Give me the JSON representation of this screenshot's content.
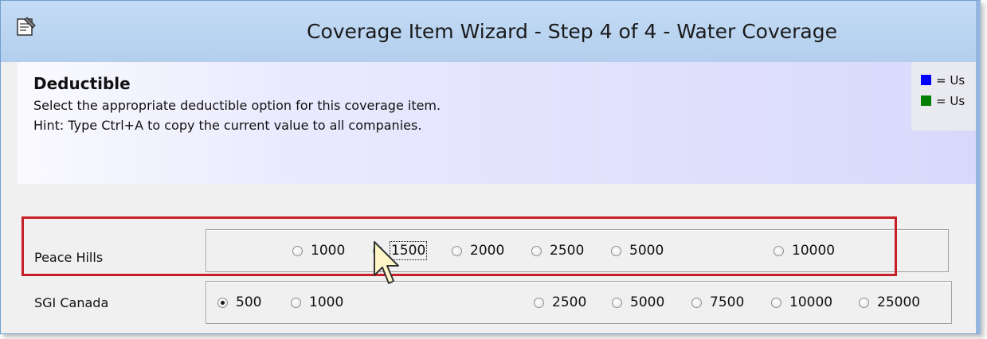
{
  "window": {
    "title": "Coverage Item Wizard - Step 4 of 4 - Water Coverage",
    "icon": "properties-icon"
  },
  "header": {
    "title": "Deductible",
    "description": "Select the appropriate deductible option for this coverage item.",
    "hint": "Hint: Type Ctrl+A to copy the current value to all companies."
  },
  "legend": {
    "items": [
      {
        "color": "#0000ff",
        "label": "= Us"
      },
      {
        "color": "#008000",
        "label": "= Us"
      }
    ]
  },
  "companies": [
    {
      "name": "Peace Hills",
      "selected": "1500",
      "options": [
        "1000",
        "1500",
        "2000",
        "2500",
        "5000",
        "10000"
      ]
    },
    {
      "name": "SGI Canada",
      "selected": "500",
      "options": [
        "500",
        "1000",
        "2500",
        "5000",
        "7500",
        "10000",
        "25000"
      ]
    }
  ],
  "colors": {
    "highlight": "#c42026",
    "titlebar": "#b9d3f0"
  }
}
